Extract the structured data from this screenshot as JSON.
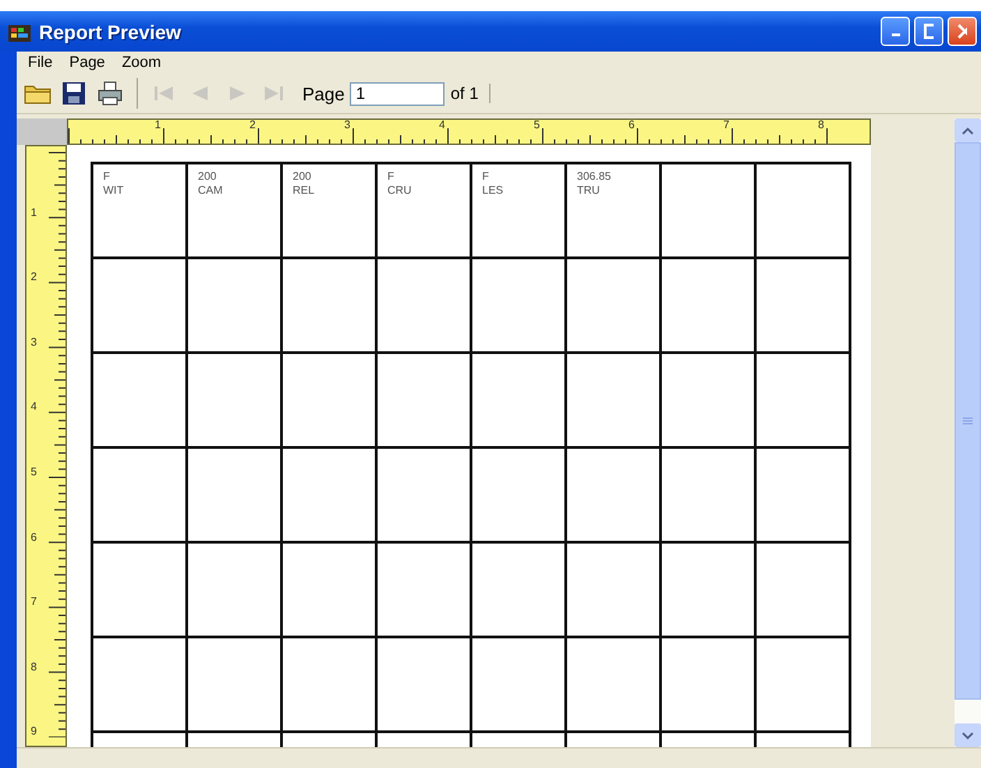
{
  "window": {
    "title": "Report Preview"
  },
  "menu": [
    "File",
    "Page",
    "Zoom"
  ],
  "toolbar": {
    "buttons": [
      {
        "kind": "open",
        "disabled": false
      },
      {
        "kind": "save",
        "disabled": false
      },
      {
        "kind": "print",
        "disabled": false
      },
      {
        "kind": "first",
        "disabled": true
      },
      {
        "kind": "prev",
        "disabled": true
      },
      {
        "kind": "next",
        "disabled": true
      },
      {
        "kind": "last",
        "disabled": true
      }
    ],
    "page_label": "Page",
    "page_value": "1",
    "page_total": "of 1"
  },
  "horizontal_ruler": [
    "1",
    "2",
    "3",
    "4",
    "5",
    "6",
    "7",
    "8"
  ],
  "vertical_ruler": [
    "1",
    "2",
    "3",
    "4",
    "5",
    "6",
    "7",
    "8",
    "9"
  ],
  "labels": [
    {
      "lines": [
        "F",
        "WIT"
      ]
    },
    {
      "lines": [
        "200",
        "CAM"
      ]
    },
    {
      "lines": [
        "200",
        "REL"
      ]
    },
    {
      "lines": [
        "F",
        "CRU"
      ]
    },
    {
      "lines": [
        "F",
        "LES"
      ]
    },
    {
      "lines": [
        "306.85",
        "TRU"
      ]
    }
  ]
}
